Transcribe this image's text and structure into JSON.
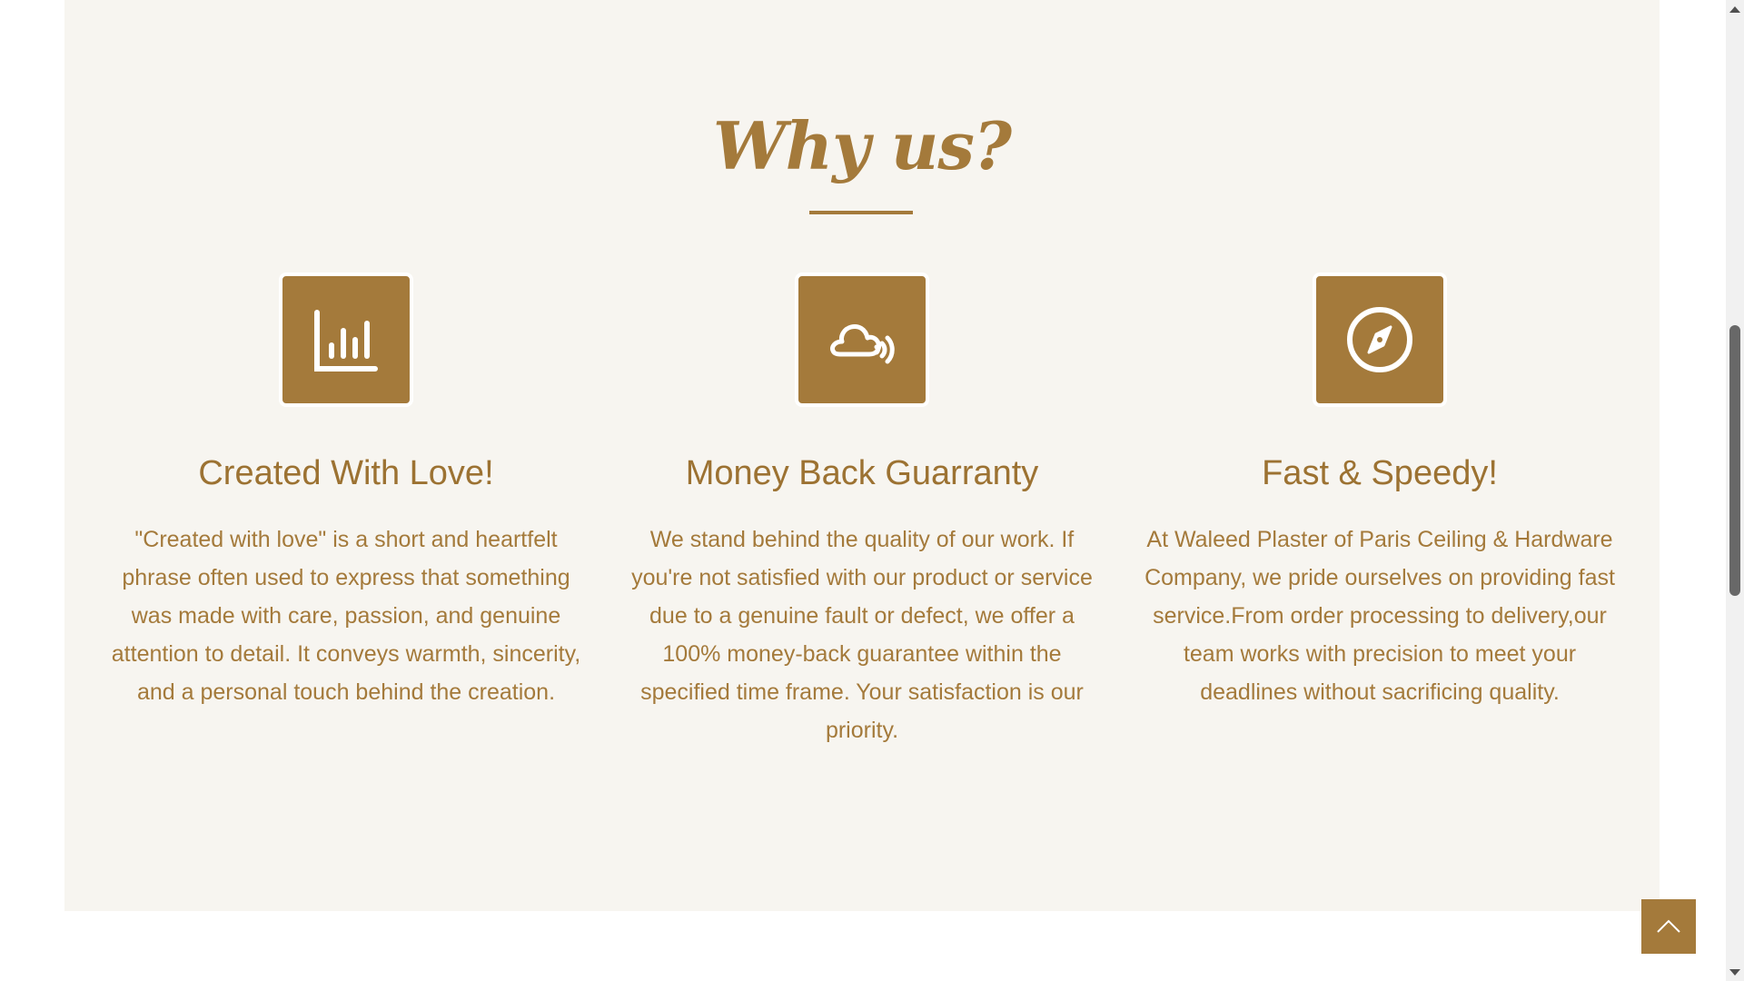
{
  "section": {
    "heading": "Why us?",
    "features": [
      {
        "icon": "bar-chart-icon",
        "title": "Created With Love!",
        "text": "\"Created with love\" is a short and heartfelt phrase often used to express that something was made with care, passion, and genuine attention to detail. It conveys warmth, sincerity, and a personal touch behind the creation."
      },
      {
        "icon": "cloud-signal-icon",
        "title": "Money Back Guarranty",
        "text": "We stand behind the quality of our work. If you're not satisfied with our product or service due to a genuine fault or defect, we offer a 100% money-back guarantee within the specified time frame. Your satisfaction is our priority."
      },
      {
        "icon": "compass-icon",
        "title": "Fast & Speedy!",
        "text": "At Waleed Plaster of Paris Ceiling & Hardware Company, we pride ourselves on providing fast service.From order processing to delivery,our team works with precision to meet your deadlines without sacrificing quality."
      }
    ]
  },
  "back_to_top_icon": "chevron-up-icon",
  "colors": {
    "accent": "#a47a3b",
    "section_bg": "#f7f5f0",
    "page_bg": "#ffffff"
  }
}
